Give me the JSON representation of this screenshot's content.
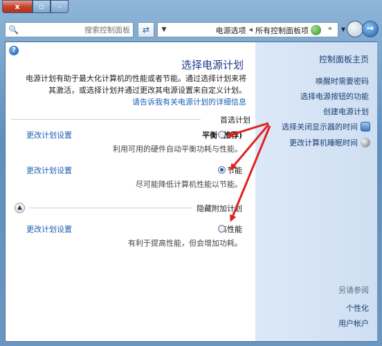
{
  "window": {
    "close_label": "x",
    "max_label": "▫",
    "min_label": "–"
  },
  "toolbar": {
    "search_placeholder": "搜索控制面板",
    "refresh_icon": "refresh-icon",
    "address_crumbs": [
      "电源选项",
      "所有控制面板项"
    ],
    "address_more": "«",
    "back_icon": "back-arrow-icon"
  },
  "sidebar": {
    "home": "控制面板主页",
    "tasks": [
      "唤醒时需要密码",
      "选择电源按钮的功能",
      "创建电源计划",
      "选择关闭显示器的时间",
      "更改计算机睡眠时间"
    ],
    "see_also": "另请参阅",
    "related": [
      "个性化",
      "用户帐户"
    ]
  },
  "main": {
    "title": "选择电源计划",
    "description_lines": [
      "电源计划有助于最大化计算机的性能或者节能。通过选择计划来将",
      "其激活，或选择计划并通过更改其电源设置来自定义计划。"
    ],
    "description_link": "请告诉我有关电源计划的详细信息",
    "preferred_label": "首选计划",
    "plans": [
      {
        "name": "平衡 (推荐)",
        "description": "利用可用的硬件自动平衡功耗与性能。",
        "link": "更改计划设置",
        "selected": false
      },
      {
        "name": "节能",
        "description": "尽可能降低计算机性能以节能。",
        "link": "更改计划设置",
        "selected": true
      }
    ],
    "additional_label": "隐藏附加计划",
    "additional_plans": [
      {
        "name": "高性能",
        "description": "有利于提高性能，但会增加功耗。",
        "link": "更改计划设置",
        "selected": false
      }
    ]
  },
  "colors": {
    "link": "#1a5fb4",
    "title": "#1e3a8a",
    "arrow": "#e02020",
    "sidebar_bg": "#dbe8f7"
  }
}
